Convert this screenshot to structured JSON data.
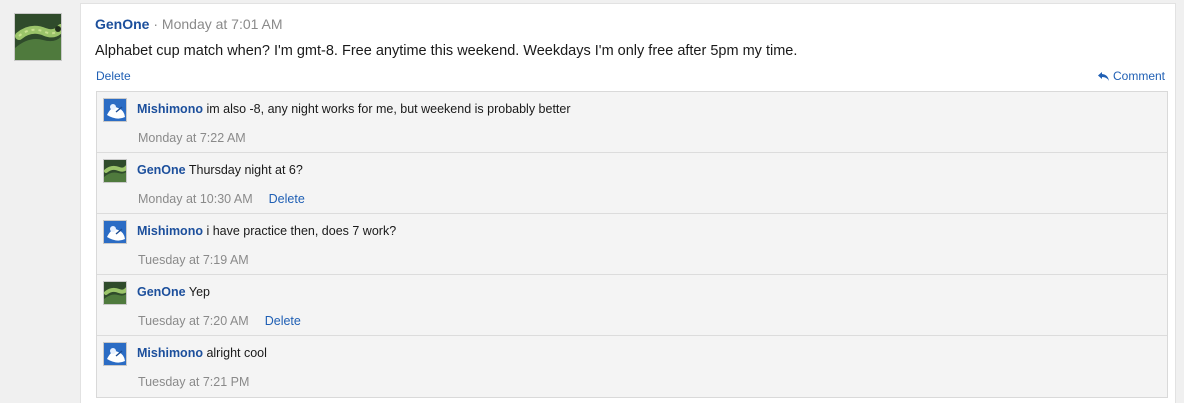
{
  "post": {
    "author": "GenOne",
    "separator": "·",
    "time": "Monday at 7:01 AM",
    "body": "Alphabet cup match when? I'm gmt-8. Free anytime this weekend. Weekdays I'm only free after 5pm my time.",
    "delete_label": "Delete",
    "comment_label": "Comment"
  },
  "replies": [
    {
      "author": "Mishimono",
      "text": "im also -8, any night works for me, but weekend is probably better",
      "time": "Monday at 7:22 AM",
      "delete_label": ""
    },
    {
      "author": "GenOne",
      "text": "Thursday night at 6?",
      "time": "Monday at 10:30 AM",
      "delete_label": "Delete"
    },
    {
      "author": "Mishimono",
      "text": "i have practice then, does 7 work?",
      "time": "Tuesday at 7:19 AM",
      "delete_label": ""
    },
    {
      "author": "GenOne",
      "text": "Yep",
      "time": "Tuesday at 7:20 AM",
      "delete_label": "Delete"
    },
    {
      "author": "Mishimono",
      "text": "alright cool",
      "time": "Tuesday at 7:21 PM",
      "delete_label": ""
    }
  ],
  "colors": {
    "author_link": "#1c4f9c",
    "action_link": "#1f5fb4",
    "muted_text": "#8a8a8a",
    "reply_background": "#f4f4f4"
  },
  "icons": {
    "comment": "reply-arrow-icon",
    "genone_avatar": "caterpillar-avatar",
    "mishimono_avatar": "blue-white-avatar"
  }
}
